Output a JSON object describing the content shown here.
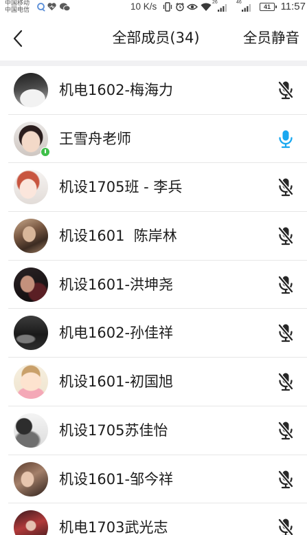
{
  "status_bar": {
    "carriers": [
      "中国移动",
      "中国电信"
    ],
    "notification_icons": [
      "qq-icon",
      "heart-app-icon",
      "wechat-icon"
    ],
    "net_speed": "10 K/s",
    "system_icons": [
      "vibrate-icon",
      "alarm-icon",
      "eye-comfort-icon",
      "wifi-icon",
      "signal-icon",
      "battery-icon"
    ],
    "signal_1_label": "26",
    "signal_2_label": "46",
    "battery": "41",
    "time": "11:57"
  },
  "header": {
    "back_icon": "back-arrow-icon",
    "title": "全部成员(34)",
    "mute_all": "全员静音"
  },
  "members": [
    {
      "name": "机电1602-梅海力",
      "muted": true
    },
    {
      "name": "王雪舟老师",
      "muted": false,
      "badge": true
    },
    {
      "name": "机设1705班 - 李兵",
      "muted": true
    },
    {
      "name": "机设1601  陈岸林",
      "muted": true
    },
    {
      "name": "机设1601-洪坤尧",
      "muted": true
    },
    {
      "name": "机电1602-孙佳祥",
      "muted": true
    },
    {
      "name": "机设1601-初国旭",
      "muted": true
    },
    {
      "name": "机设1705苏佳怡",
      "muted": true
    },
    {
      "name": "机设1601-邹今祥",
      "muted": true
    },
    {
      "name": "机电1703武光志",
      "muted": true
    }
  ],
  "icons": {
    "muted_mic": "mic-muted-icon",
    "active_mic": "mic-icon"
  },
  "theme": {
    "accent": "#19a8f0",
    "mic_muted": "#262626",
    "text": "#1c1c1c",
    "divider": "#e6e6e6",
    "band": "#f1f1f3",
    "badge": "#3fbf4a"
  }
}
